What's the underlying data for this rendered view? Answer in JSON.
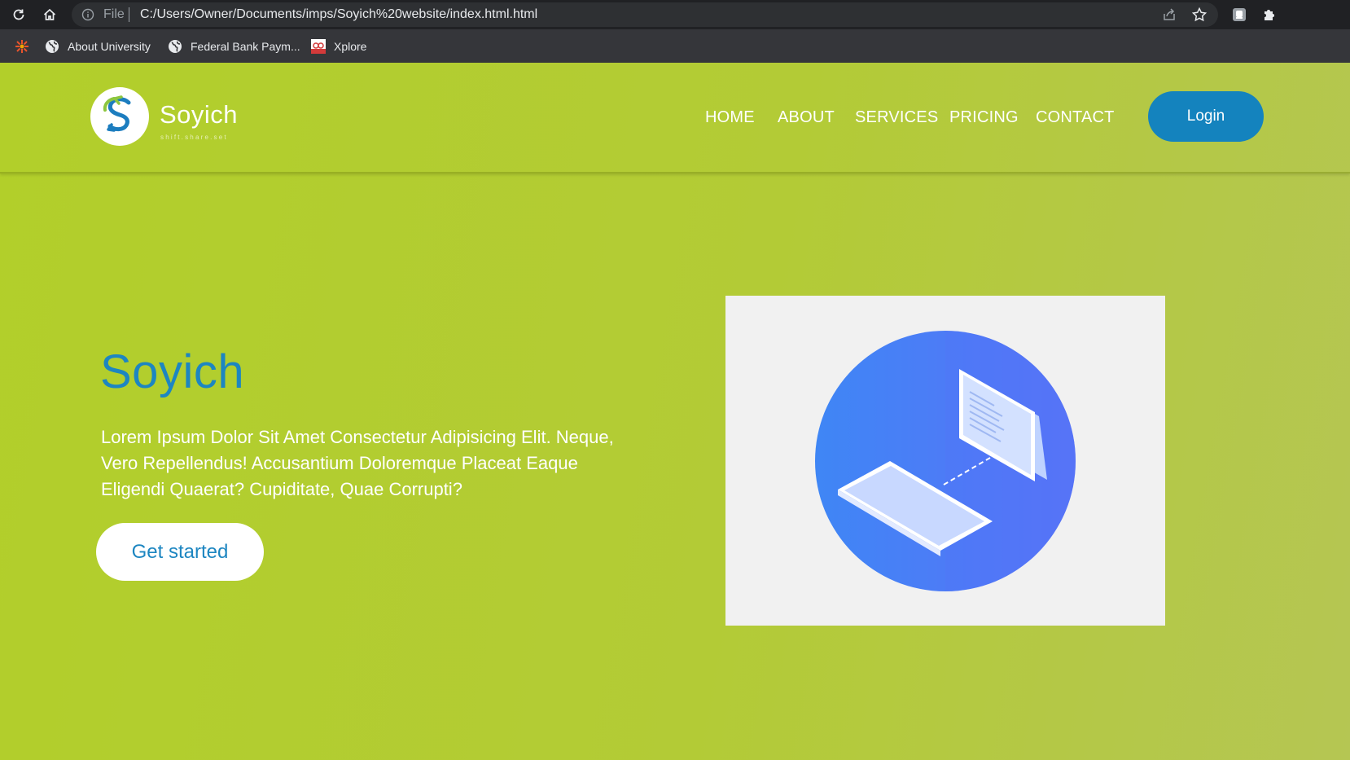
{
  "browser": {
    "omnibox": {
      "scheme_label": "File",
      "url": "C:/Users/Owner/Documents/imps/Soyich%20website/index.html.html"
    },
    "bookmarks": [
      {
        "label": "About University",
        "icon": "globe-icon"
      },
      {
        "label": "Federal Bank Paym...",
        "icon": "globe-icon"
      },
      {
        "label": "Xplore",
        "icon": "xplore-favicon"
      }
    ]
  },
  "site": {
    "brand": {
      "name": "Soyich",
      "tagline": "shift.share.set"
    },
    "nav": [
      {
        "label": "HOME"
      },
      {
        "label": "ABOUT"
      },
      {
        "label": "SERVICES"
      },
      {
        "label": "PRICING"
      },
      {
        "label": "CONTACT"
      }
    ],
    "login_label": "Login",
    "hero": {
      "title": "Soyich",
      "text": "Lorem Ipsum Dolor Sit Amet Consectetur Adipisicing Elit. Neque, Vero Repellendus! Accusantium Doloremque Placeat Eaque Eligendi Quaerat? Cupiditate, Quae Corrupti?",
      "cta_label": "Get started"
    }
  },
  "colors": {
    "page_green": "#b3cb36",
    "accent_blue": "#1d86c1",
    "login_blue": "#1483be",
    "illustration_blue": "#4a7ff7"
  }
}
